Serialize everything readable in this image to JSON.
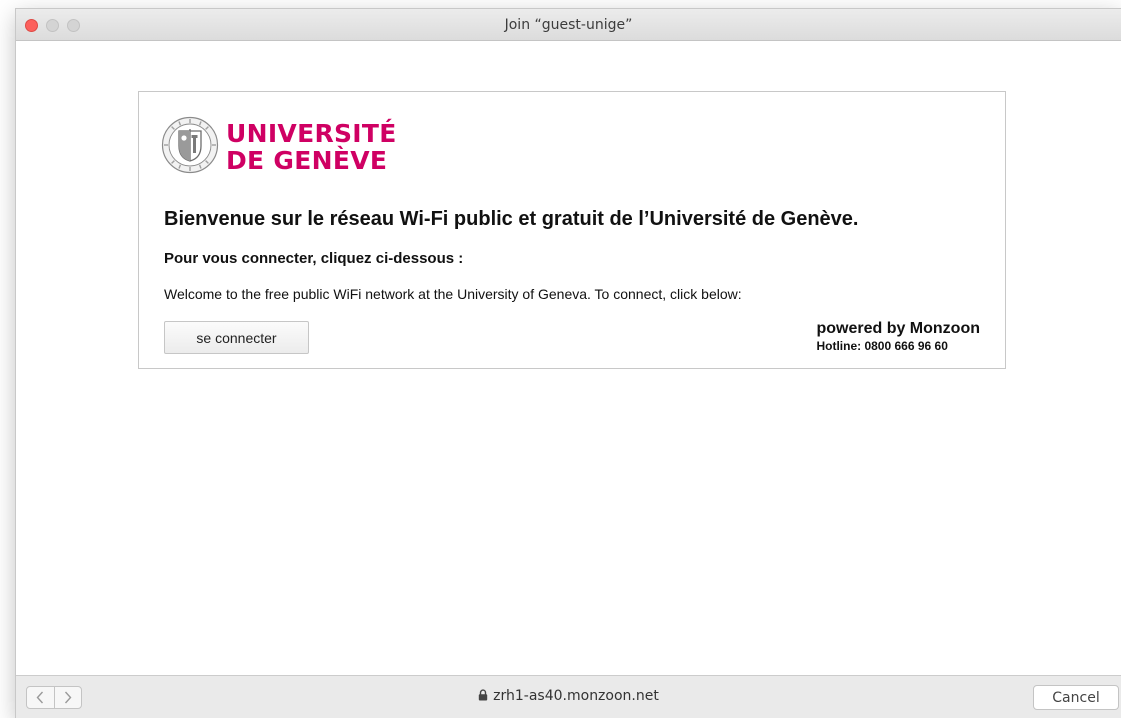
{
  "window": {
    "title": "Join “guest-unige”",
    "controls": [
      "close",
      "minimize",
      "zoom"
    ]
  },
  "portal": {
    "logo": {
      "line1": "UNIVERSITÉ",
      "line2": "DE GENÈVE",
      "seal_icon": "university-seal-icon",
      "brand_color": "#cf0063"
    },
    "headline": "Bienvenue sur le réseau Wi-Fi public et gratuit de l’Université de Genève.",
    "subhead": "Pour vous connecter, cliquez ci-dessous :",
    "english_text": "Welcome to the free public WiFi network at the University of Geneva. To connect, click below:",
    "connect_label": "se connecter",
    "powered_by": "powered by Monzoon",
    "hotline": "Hotline: 0800 666 96 60"
  },
  "footer": {
    "back_icon": "chevron-left-icon",
    "forward_icon": "chevron-right-icon",
    "url_icon": "lock-icon",
    "url": "zrh1-as40.monzoon.net",
    "cancel_label": "Cancel"
  }
}
